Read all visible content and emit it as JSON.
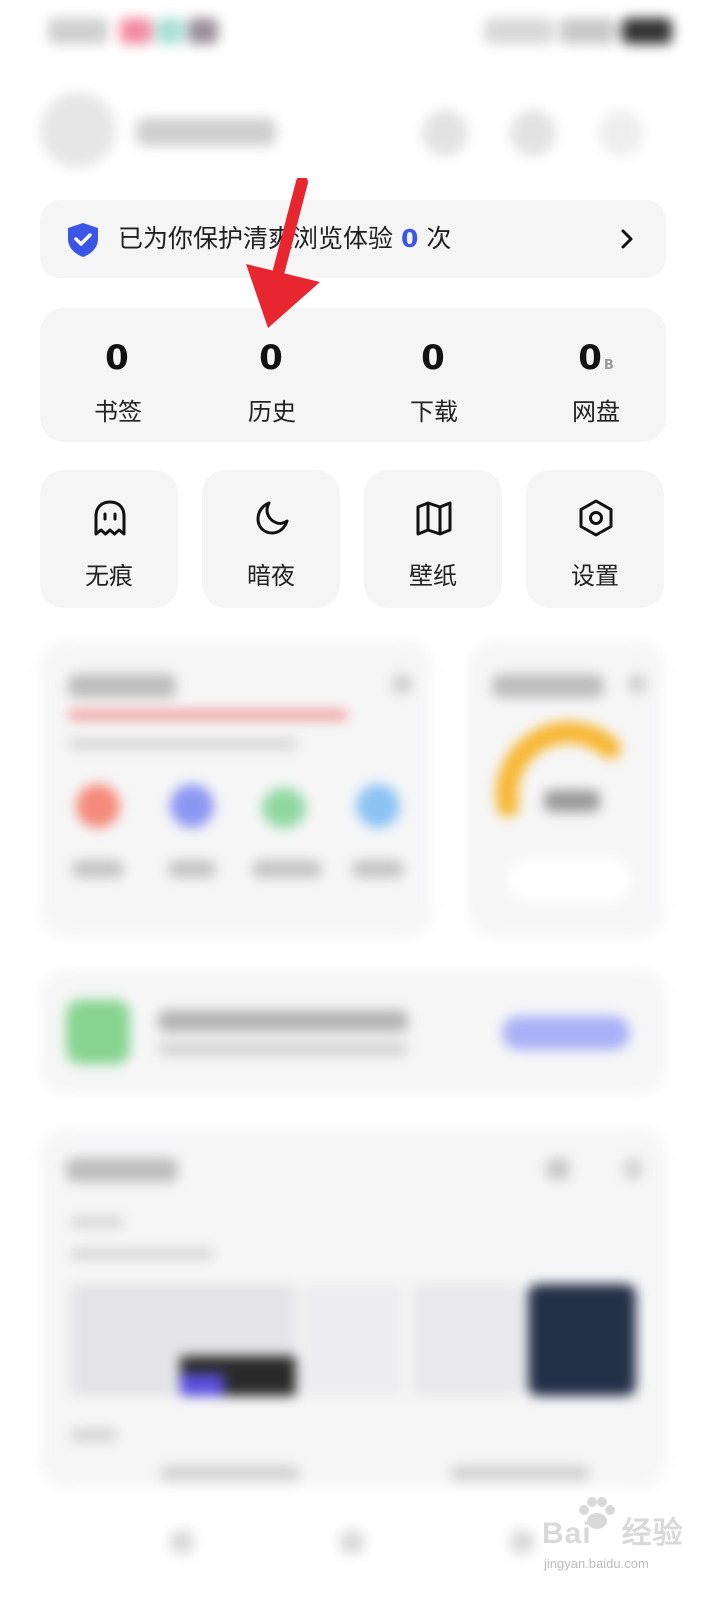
{
  "protect_banner": {
    "prefix": "已为你保护清爽浏览体验",
    "count": "0",
    "suffix": "次"
  },
  "stats": [
    {
      "value": "0",
      "unit": "",
      "label": "书签"
    },
    {
      "value": "0",
      "unit": "",
      "label": "历史"
    },
    {
      "value": "0",
      "unit": "",
      "label": "下载"
    },
    {
      "value": "0",
      "unit": "B",
      "label": "网盘"
    }
  ],
  "quick_tools": [
    {
      "label": "无痕",
      "icon": "ghost-icon"
    },
    {
      "label": "暗夜",
      "icon": "moon-icon"
    },
    {
      "label": "壁纸",
      "icon": "map-book-icon"
    },
    {
      "label": "设置",
      "icon": "hexagon-settings-icon"
    }
  ],
  "watermark": {
    "brand": "Bai",
    "brand2": "经验",
    "site": "jingyan.baidu.com"
  },
  "colors": {
    "accent_blue": "#3b55e6",
    "annotation_red": "#e8262f",
    "card_bg": "#f5f5f6"
  }
}
